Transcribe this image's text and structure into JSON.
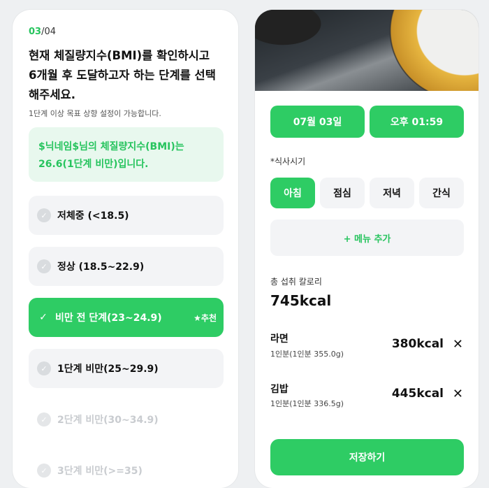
{
  "left": {
    "step_current": "03",
    "step_total": "/04",
    "question": "현재 체질량지수(BMI)를 확인하시고\n6개월 후 도달하고자 하는 단계를 선택\n해주세요.",
    "subtitle": "1단계 이상 목표 상향 설정이 가능합니다.",
    "bmi_info": "$닉네임$님의 체질량지수(BMI)는\n26.6(1단계 비만)입니다.",
    "options": [
      {
        "label": "저체중 (<18.5)"
      },
      {
        "label": "정상 (18.5~22.9)"
      },
      {
        "label": "비만 전 단계(23~24.9)",
        "badge": "★추천"
      },
      {
        "label": "1단계 비만(25~29.9)"
      },
      {
        "label": "2단계 비만(30~34.9)"
      },
      {
        "label": "3단계 비만(>=35)"
      }
    ]
  },
  "right": {
    "date": "07월 03일",
    "time": "오후 01:59",
    "meal_time_label": "*식사시기",
    "meals": [
      "아침",
      "점심",
      "저녁",
      "간식"
    ],
    "add_menu": "+ 메뉴 추가",
    "total_label": "총 섭취 칼로리",
    "total_value": "745kcal",
    "foods": [
      {
        "name": "라면",
        "serving": "1인분(1인분 355.0g)",
        "kcal": "380kcal",
        "remove": "✕"
      },
      {
        "name": "김밥",
        "serving": "1인분(1인분 336.5g)",
        "kcal": "445kcal",
        "remove": "✕"
      }
    ],
    "save": "저장하기"
  }
}
